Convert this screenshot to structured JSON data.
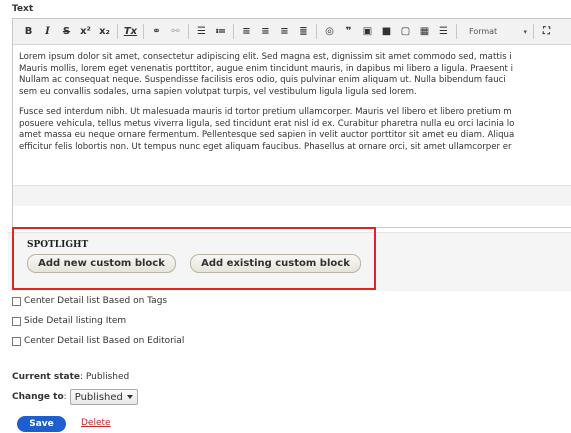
{
  "field_label": "Text",
  "editor": {
    "toolbar_format_label": "Format",
    "toolbar_icons": [
      "bold-icon",
      "italic-icon",
      "strikethrough-icon",
      "superscript-icon",
      "subscript-icon",
      "remove-format-icon",
      "link-icon",
      "unlink-icon",
      "bulleted-list-icon",
      "numbered-list-icon",
      "align-left-icon",
      "align-center-icon",
      "align-right-icon",
      "justify-icon",
      "globe-icon",
      "blockquote-icon",
      "image-icon",
      "media-icon",
      "template-icon",
      "table-icon",
      "horizontal-rule-icon",
      "maximize-icon"
    ],
    "paragraph_1": [
      "Lorem ipsum dolor sit amet, consectetur adipiscing elit. Sed magna est, dignissim sit amet commodo sed, mattis i",
      "Mauris mollis, lorem eget venenatis porttitor, augue enim tincidunt mauris, in dapibus mi libero a ligula. Praesent i",
      "Nullam ac consequat neque. Suspendisse facilisis eros odio, quis pulvinar enim aliquam ut. Nulla bibendum fauci",
      "sem eu convallis sodales, urna sapien volutpat turpis, vel vestibulum ligula ligula sed lorem."
    ],
    "paragraph_2": [
      "Fusce sed interdum nibh. Ut malesuada mauris id tortor pretium ullamcorper. Mauris vel libero et libero pretium m",
      "posuere vehicula, tellus metus viverra ligula, sed tincidunt erat nisl id ex. Curabitur pharetra nulla eu orci lacinia lo",
      "amet massa eu neque ornare fermentum. Pellentesque sed sapien in velit auctor porttitor sit amet eu diam. Aliqua",
      "efficitur felis lobortis non. Ut tempus nunc eget aliquam faucibus. Phasellus at ornare orci, sit amet ullamcorper er"
    ]
  },
  "spotlight": {
    "label": "SPOTLIGHT",
    "add_new_label": "Add new custom block",
    "add_existing_label": "Add existing custom block",
    "highlight_color": "#e02424"
  },
  "checkboxes": [
    {
      "label": "Center Detail list Based on Tags",
      "checked": false
    },
    {
      "label": "Side Detail listing Item",
      "checked": false
    },
    {
      "label": "Center Detail list Based on Editorial",
      "checked": false
    }
  ],
  "moderation": {
    "current_state_label": "Current state",
    "current_state_value": "Published",
    "change_to_label": "Change to",
    "change_to_value": "Published"
  },
  "actions": {
    "save_label": "Save",
    "delete_label": "Delete",
    "save_color": "#1e5fcf",
    "delete_color": "#c1272d"
  }
}
